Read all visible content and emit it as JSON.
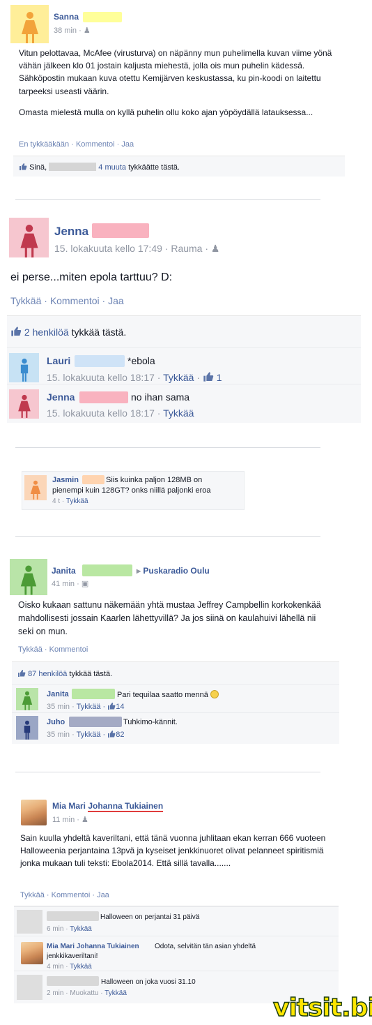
{
  "colors": {
    "link": "#3b5998",
    "female_yellow_bg": "#ffee99",
    "female_pink_bg": "#f6c6cf",
    "male_blue_bg": "#c7e2f4",
    "female_orange_bg": "#fbd6b8",
    "female_green_bg": "#b9e4a8",
    "male_navy_bg": "#9aa6c5",
    "watermark": "#ffe600"
  },
  "post1": {
    "author": "Sanna",
    "time": "38 min ·",
    "text_p1": "Vitun pelottavaa, McAfee (virusturva) on näpänny mun puhelimella kuvan viime yönä vähän jälkeen klo 01 jostain kaljusta miehestä, jolla ois mun puhelin kädessä. Sähköpostin mukaan kuva otettu Kemijärven keskustassa, ku pin-koodi on laitettu tarpeeksi useasti väärin.",
    "text_p2": "Omasta mielestä mulla on kyllä puhelin ollu koko ajan yöpöydällä latauksessa...",
    "actions": [
      "En tykkääkään",
      "Kommentoi",
      "Jaa"
    ],
    "likes_prefix": "Sinä,",
    "likes_link": "4 muuta",
    "likes_suffix": "tykkäätte tästä."
  },
  "post2": {
    "author": "Jenna",
    "time": "15. lokakuuta kello 17:49 · Rauma ·",
    "text": "ei perse...miten epola tarttuu? D:",
    "actions": [
      "Tykkää",
      "Kommentoi",
      "Jaa"
    ],
    "likes_link": "2 henkilöä",
    "likes_suffix": "tykkää tästä.",
    "comments": [
      {
        "author": "Lauri",
        "text": "*ebola",
        "time": "15. lokakuuta kello 18:17 ·",
        "like": "Tykkää",
        "count": "1"
      },
      {
        "author": "Jenna",
        "text": "no ihan sama",
        "time": "15. lokakuuta kello 18:17 ·",
        "like": "Tykkää"
      }
    ]
  },
  "post3": {
    "author": "Jasmin",
    "text_l1": "Siis kuinka paljon 128MB on",
    "text_l2": "pienempi kuin 128GT? onks niillä paljonki eroa",
    "time": "4 t ·",
    "like": "Tykkää"
  },
  "post4": {
    "author": "Janita",
    "target": "Puskaradio Oulu",
    "time": "41 min ·",
    "text": "Oisko kukaan sattunu näkemään yhtä mustaa Jeffrey Campbellin korkokenkää mahdollisesti jossain Kaarlen lähettyvillä? Ja jos siinä on kaulahuivi lähellä nii seki on mun.",
    "actions": [
      "Tykkää",
      "Kommentoi"
    ],
    "likes_link": "87 henkilöä",
    "likes_suffix": "tykkää tästä.",
    "comments": [
      {
        "author": "Janita",
        "text": "Pari tequilaa saatto mennä",
        "time": "35 min ·",
        "like": "Tykkää ·",
        "count": "14"
      },
      {
        "author": "Juho",
        "text": "Tuhkimo-kännit.",
        "time": "35 min ·",
        "like": "Tykkää ·",
        "count": "82"
      }
    ]
  },
  "post5": {
    "author_first": "Mia Mari",
    "author_last": "Johanna Tukiainen",
    "time": "11 min ·",
    "text": "Sain kuulla yhdeltä kaveriltani, että tänä vuonna juhlitaan ekan kerran 666 vuoteen Halloweenia perjantaina 13pvä ja kyseiset jenkkinuoret olivat pelanneet spiritismiä jonka mukaan tuli teksti: Ebola2014. Että sillä tavalla.......",
    "actions": [
      "Tykkää",
      "Kommentoi",
      "Jaa"
    ],
    "comments": [
      {
        "text": "Halloween on perjantai 31 päivä",
        "time": "6 min ·",
        "like": "Tykkää"
      },
      {
        "author": "Mia Mari Johanna Tukiainen",
        "text_l1": "Odota, selvitän tän asian yhdeltä",
        "text_l2": "jenkkikaveriltani!",
        "time": "4 min ·",
        "like": "Tykkää"
      },
      {
        "text": "Halloween on joka vuosi 31.10",
        "time": "2 min · Muokattu ·",
        "like": "Tykkää"
      }
    ]
  },
  "watermark": "vitsit.biz"
}
